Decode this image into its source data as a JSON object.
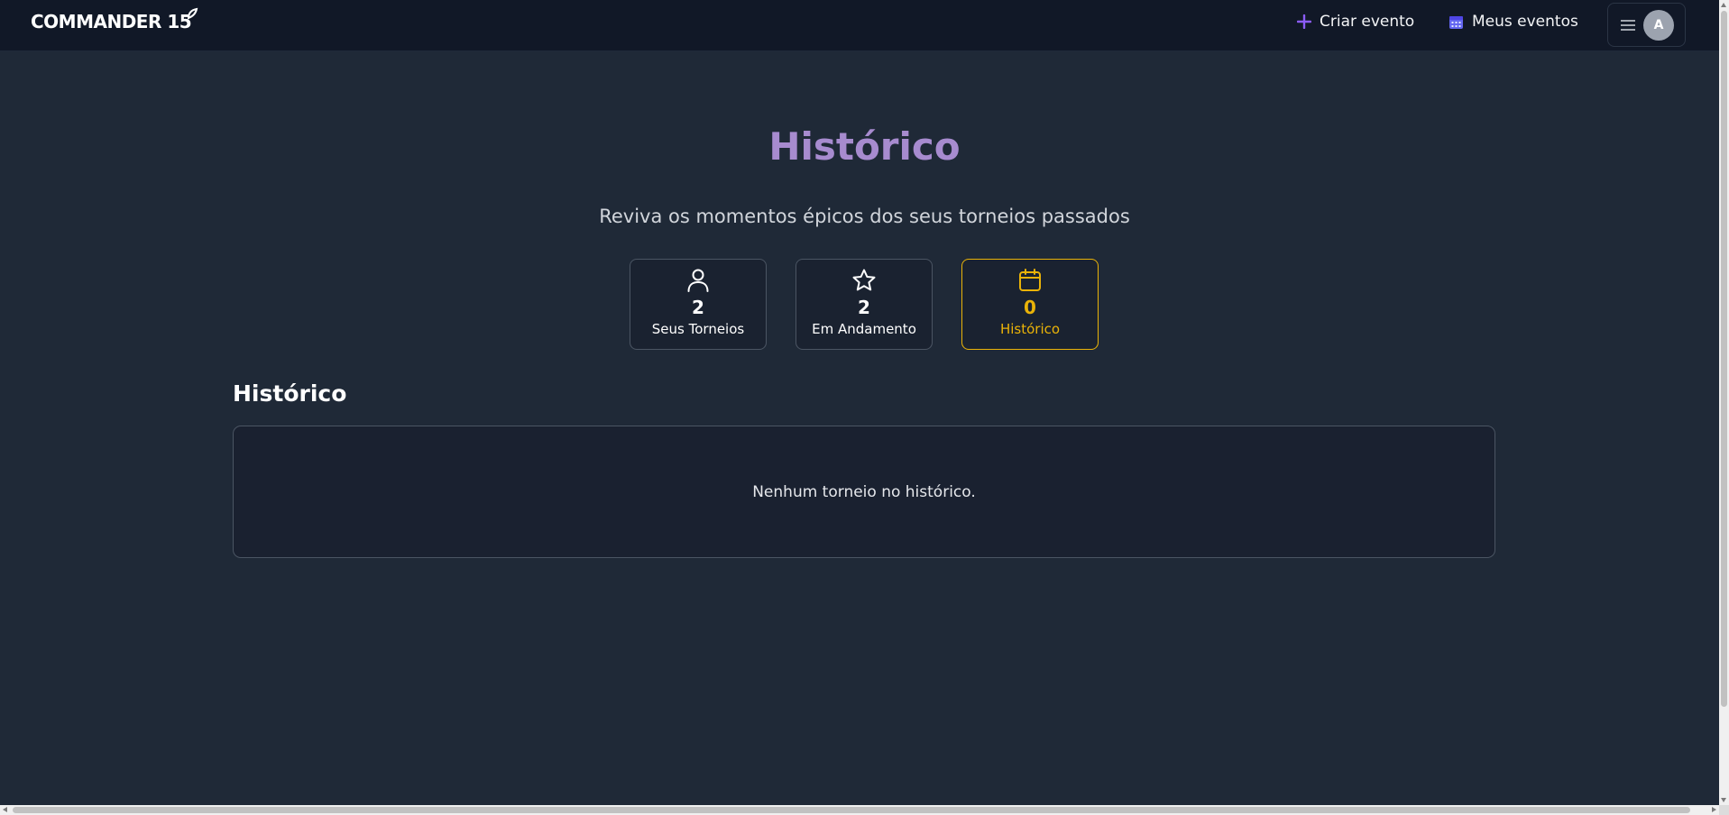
{
  "header": {
    "logo_text": "COMMANDER 15",
    "create_event_label": "Criar evento",
    "my_events_label": "Meus eventos",
    "avatar_initial": "A",
    "colors": {
      "create_icon": "#8b5cf6",
      "calendar_icon": "#6366f1"
    }
  },
  "hero": {
    "title": "Histórico",
    "subtitle": "Reviva os momentos épicos dos seus torneios passados",
    "title_color": "#a78bcf"
  },
  "stats": [
    {
      "icon": "user-icon",
      "value": "2",
      "label": "Seus Torneios",
      "active": false
    },
    {
      "icon": "star-icon",
      "value": "2",
      "label": "Em Andamento",
      "active": false
    },
    {
      "icon": "calendar-icon",
      "value": "0",
      "label": "Histórico",
      "active": true
    }
  ],
  "active_color": "#eab308",
  "section": {
    "title": "Histórico",
    "empty_message": "Nenhum torneio no histórico."
  }
}
